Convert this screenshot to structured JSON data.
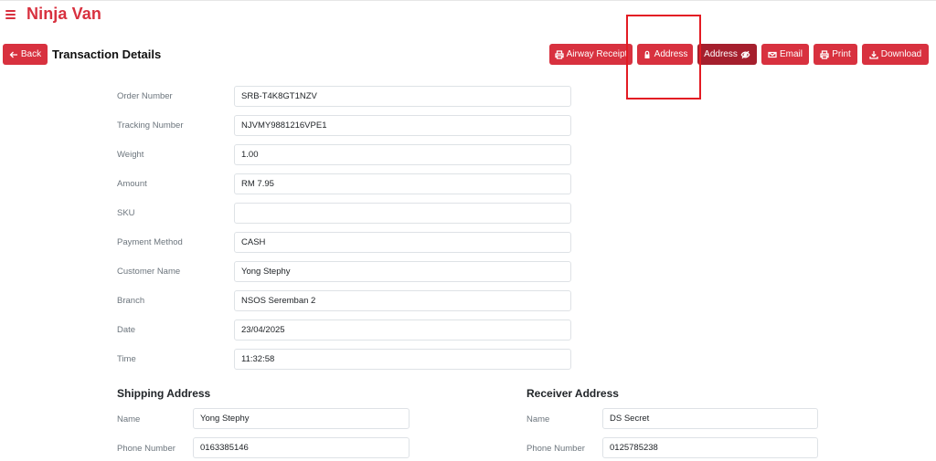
{
  "app": {
    "brand": "Ninja Van"
  },
  "header": {
    "back_label": "Back",
    "title": "Transaction Details"
  },
  "actions": {
    "airway_receipt": "Airway Receipt",
    "address_locked": "Address",
    "address_view": "Address",
    "email": "Email",
    "print": "Print",
    "download": "Download"
  },
  "details": [
    {
      "label": "Order Number",
      "value": "SRB-T4K8GT1NZV"
    },
    {
      "label": "Tracking Number",
      "value": "NJVMY9881216VPE1"
    },
    {
      "label": "Weight",
      "value": "1.00"
    },
    {
      "label": "Amount",
      "value": "RM 7.95"
    },
    {
      "label": "SKU",
      "value": ""
    },
    {
      "label": "Payment Method",
      "value": "CASH"
    },
    {
      "label": "Customer Name",
      "value": "Yong Stephy"
    },
    {
      "label": "Branch",
      "value": "NSOS Seremban 2"
    },
    {
      "label": "Date",
      "value": "23/04/2025"
    },
    {
      "label": "Time",
      "value": "11:32:58"
    }
  ],
  "shipping": {
    "title": "Shipping Address",
    "name_label": "Name",
    "name": "Yong Stephy",
    "phone_label": "Phone Number",
    "phone": "0163385146"
  },
  "receiver": {
    "title": "Receiver Address",
    "name_label": "Name",
    "name": "DS Secret",
    "phone_label": "Phone Number",
    "phone": "0125785238"
  },
  "colors": {
    "brand": "#d8313f",
    "brand_dark": "#a51f2d",
    "highlight": "#e31b23"
  }
}
